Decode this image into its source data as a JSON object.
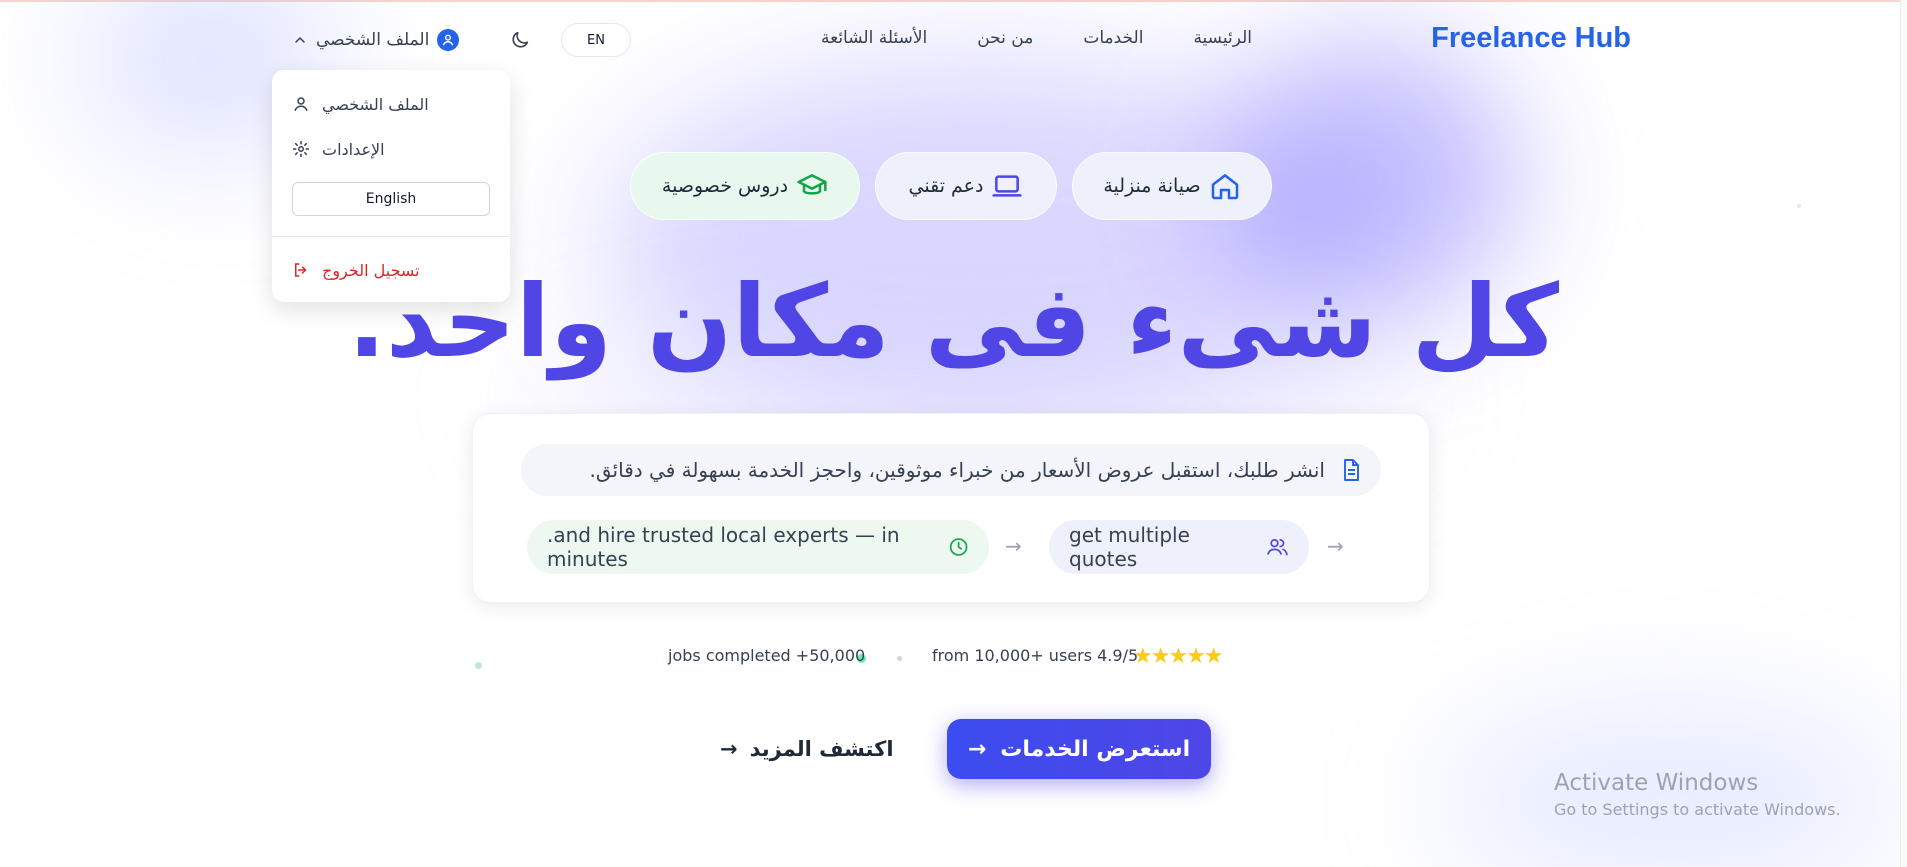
{
  "nav": {
    "brand": "Freelance Hub",
    "links": [
      "الرئيسية",
      "الخدمات",
      "من نحن",
      "الأسئلة الشائعة"
    ],
    "language_toggle": "EN",
    "profile_label": "الملف الشخصي"
  },
  "profile_menu": {
    "profile": "الملف الشخصي",
    "settings": "الإعدادات",
    "language_button": "English",
    "logout": "تسجيل الخروج"
  },
  "categories": [
    {
      "label": "صيانة منزلية",
      "icon": "home-icon"
    },
    {
      "label": "دعم تقني",
      "icon": "laptop-icon"
    },
    {
      "label": "دروس خصوصية",
      "icon": "graduation-cap-icon"
    }
  ],
  "hero": {
    "title": "كل شىء فى مكان واحد."
  },
  "info_card": {
    "description": ".انشر طلبك، استقبل عروض الأسعار من خبراء موثوقين، واحجز الخدمة بسهولة في دقائق",
    "step1": "get multiple quotes",
    "step2": ".and hire trusted local experts — in minutes"
  },
  "stats": {
    "rating": "from 10,000+ users 4.9/5",
    "jobs": "jobs completed +50,000",
    "stars": "★★★★★"
  },
  "actions": {
    "primary": "استعرض الخدمات",
    "secondary": "اكتشف المزيد"
  },
  "watermark": {
    "line1": "Activate Windows",
    "line2": "Go to Settings to activate Windows."
  },
  "colors": {
    "brand": "#2563eb",
    "hero": "#4f46e5",
    "logout": "#dc2626",
    "star": "#facc15"
  }
}
